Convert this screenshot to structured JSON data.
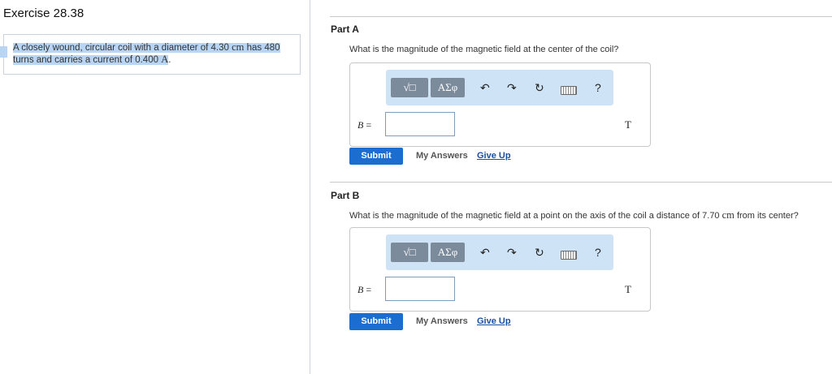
{
  "exercise": {
    "title": "Exercise 28.38"
  },
  "problem": {
    "line1": "A closely wound, circular coil with a diameter of 4.30 ",
    "unit1": "cm",
    "line1b": " has 480",
    "line2": "turns and carries a current of 0.400 ",
    "unit2": "A",
    "line2b": "."
  },
  "toolbar": {
    "template_label": "√□",
    "symbols_label": "ΑΣφ",
    "help_label": "?"
  },
  "parts": [
    {
      "label": "Part A",
      "question": "What is the magnitude of the magnetic field at the center of the coil?",
      "var": "B",
      "eq": " =",
      "unit": "T",
      "submit": "Submit",
      "my_answers": "My Answers",
      "give_up": "Give Up"
    },
    {
      "label": "Part B",
      "question": "What is the magnitude of the magnetic field at a point on the axis of the coil a distance of 7.70 ",
      "question_unit": "cm",
      "question_end": " from its center?",
      "var": "B",
      "eq": " =",
      "unit": "T",
      "submit": "Submit",
      "my_answers": "My Answers",
      "give_up": "Give Up"
    }
  ]
}
